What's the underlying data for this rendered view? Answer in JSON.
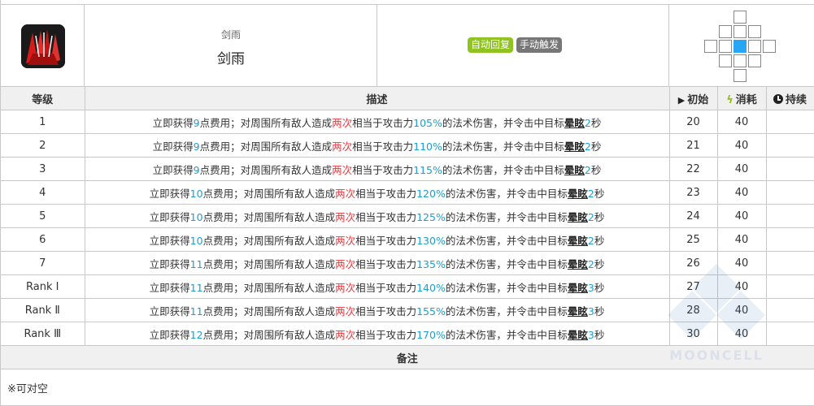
{
  "skill": {
    "name_small": "剑雨",
    "name": "剑雨",
    "tags": [
      "自动回复",
      "手动触发"
    ]
  },
  "colors": {
    "accent": "#1a9fd6",
    "highlight": "#e8383d",
    "auto_tag": "#8fc31f",
    "manual_tag": "#777777",
    "range_self": "#27a6f5"
  },
  "icons": [
    "sword-rain-icon",
    "play-icon",
    "bolt-icon",
    "clock-icon"
  ],
  "table": {
    "headers": {
      "level": "等级",
      "desc": "描述",
      "initial": "初始",
      "cost": "消耗",
      "duration": "持续"
    },
    "rows": [
      {
        "level": "1",
        "sp": "9",
        "mult": "105%",
        "stun": "2",
        "initial": "20",
        "cost": "40",
        "duration": ""
      },
      {
        "level": "2",
        "sp": "9",
        "mult": "110%",
        "stun": "2",
        "initial": "21",
        "cost": "40",
        "duration": ""
      },
      {
        "level": "3",
        "sp": "9",
        "mult": "115%",
        "stun": "2",
        "initial": "22",
        "cost": "40",
        "duration": ""
      },
      {
        "level": "4",
        "sp": "10",
        "mult": "120%",
        "stun": "2",
        "initial": "23",
        "cost": "40",
        "duration": ""
      },
      {
        "level": "5",
        "sp": "10",
        "mult": "125%",
        "stun": "2",
        "initial": "24",
        "cost": "40",
        "duration": ""
      },
      {
        "level": "6",
        "sp": "10",
        "mult": "130%",
        "stun": "2",
        "initial": "25",
        "cost": "40",
        "duration": ""
      },
      {
        "level": "7",
        "sp": "11",
        "mult": "135%",
        "stun": "2",
        "initial": "26",
        "cost": "40",
        "duration": ""
      },
      {
        "level": "Rank Ⅰ",
        "sp": "11",
        "mult": "140%",
        "stun": "3",
        "initial": "27",
        "cost": "40",
        "duration": ""
      },
      {
        "level": "Rank Ⅱ",
        "sp": "11",
        "mult": "155%",
        "stun": "3",
        "initial": "28",
        "cost": "40",
        "duration": ""
      },
      {
        "level": "Rank Ⅲ",
        "sp": "12",
        "mult": "170%",
        "stun": "3",
        "initial": "30",
        "cost": "40",
        "duration": ""
      }
    ],
    "desc_parts": {
      "p1": "立即获得",
      "p2": "点费用；对周围所有敌人造成",
      "twice": "两次",
      "p3": "相当于攻击力",
      "p4": "的法术伤害，并令击中目标",
      "stun_word": "晕眩",
      "p5": "秒"
    },
    "note_header": "备注",
    "note": "※可对空"
  },
  "watermark": "MOONCELL"
}
